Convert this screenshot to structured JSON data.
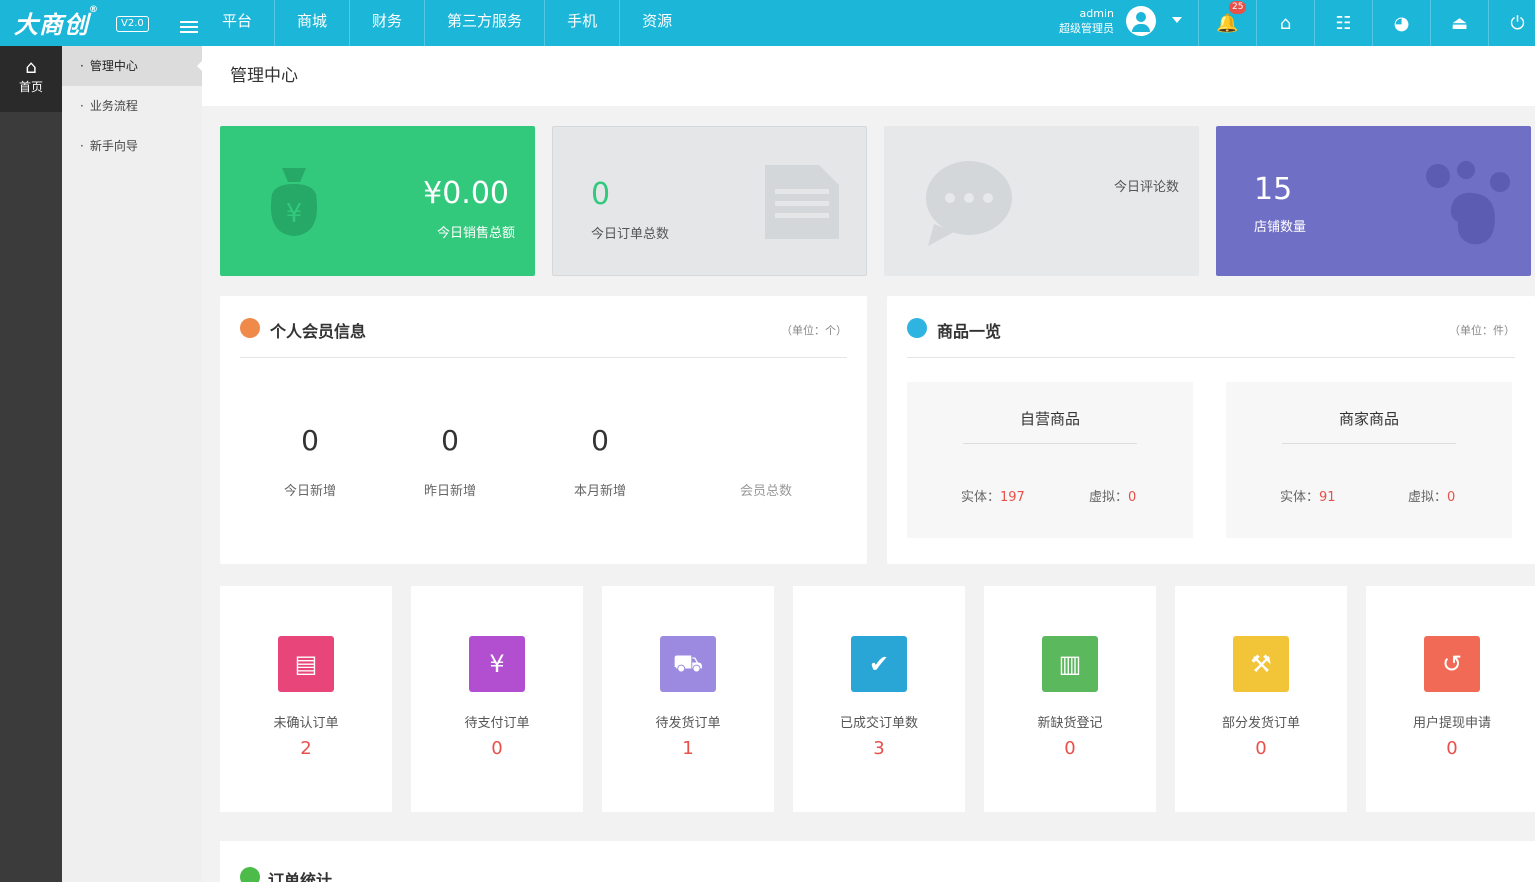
{
  "header": {
    "logo": "大商创",
    "logo_mark": "®",
    "version": "V2.0",
    "nav": [
      "平台",
      "商城",
      "财务",
      "第三方服务",
      "手机",
      "资源"
    ],
    "user_name": "admin",
    "user_role": "超级管理员",
    "notification_count": "25"
  },
  "rail": {
    "home_label": "首页"
  },
  "subnav": {
    "items": [
      "管理中心",
      "业务流程",
      "新手向导"
    ]
  },
  "page_title": "管理中心",
  "stats": [
    {
      "value": "¥0.00",
      "label": "今日销售总额",
      "icon": "money-bag-icon",
      "color": "#33c97c"
    },
    {
      "value": "0",
      "label": "今日订单总数",
      "icon": "document-icon",
      "color": "#e4e6e8"
    },
    {
      "value": "",
      "label": "今日评论数",
      "icon": "chat-bubble-icon",
      "color": "#e6e8ea"
    },
    {
      "value": "15",
      "label": "店铺数量",
      "icon": "paw-icon",
      "color": "#6f6fc6"
    }
  ],
  "members": {
    "title": "个人会员信息",
    "unit": "（单位：个）",
    "items": [
      {
        "value": "0",
        "label": "今日新增"
      },
      {
        "value": "0",
        "label": "昨日新增"
      },
      {
        "value": "0",
        "label": "本月新增"
      },
      {
        "value": "",
        "label": "会员总数"
      }
    ]
  },
  "goods": {
    "title": "商品一览",
    "unit": "（单位：件）",
    "groups": [
      {
        "title": "自营商品",
        "physical_label": "实体：",
        "physical": "197",
        "virtual_label": "虚拟：",
        "virtual": "0"
      },
      {
        "title": "商家商品",
        "physical_label": "实体：",
        "physical": "91",
        "virtual_label": "虚拟：",
        "virtual": "0"
      }
    ]
  },
  "orders": [
    {
      "label": "未确认订单",
      "count": "2",
      "color": "#e8457a",
      "icon": "document-icon"
    },
    {
      "label": "待支付订单",
      "count": "0",
      "color": "#b24fd1",
      "icon": "money-bag-icon"
    },
    {
      "label": "待发货订单",
      "count": "1",
      "color": "#9b8ae0",
      "icon": "truck-icon"
    },
    {
      "label": "已成交订单数",
      "count": "3",
      "color": "#2aa6d6",
      "icon": "clipboard-check-icon"
    },
    {
      "label": "新缺货登记",
      "count": "0",
      "color": "#5cb85c",
      "icon": "notebook-icon"
    },
    {
      "label": "部分发货订单",
      "count": "0",
      "color": "#f2c438",
      "icon": "hand-truck-icon"
    },
    {
      "label": "用户提现申请",
      "count": "0",
      "color": "#f06a55",
      "icon": "refund-icon"
    }
  ],
  "order_stats": {
    "title": "订单统计"
  }
}
